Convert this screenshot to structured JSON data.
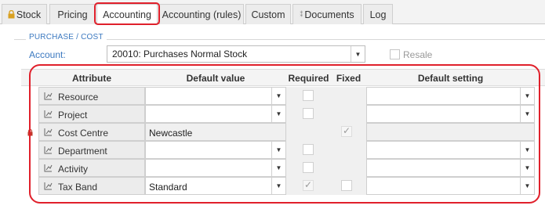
{
  "tabs": [
    {
      "label": "Stock",
      "icon": "lock-icon"
    },
    {
      "label": "Pricing"
    },
    {
      "label": "Accounting",
      "active": true
    },
    {
      "label": "Accounting (rules)"
    },
    {
      "label": "Custom"
    },
    {
      "label": "Documents",
      "icon": "documents-icon"
    },
    {
      "label": "Log"
    }
  ],
  "section": {
    "title": "PURCHASE / COST"
  },
  "account": {
    "label": "Account:",
    "value": "20010: Purchases Normal Stock"
  },
  "resale": {
    "label": "Resale",
    "checked": false
  },
  "table": {
    "headers": {
      "attribute": "Attribute",
      "default_value": "Default value",
      "required": "Required",
      "fixed": "Fixed",
      "default_setting": "Default setting"
    },
    "rows": [
      {
        "attribute": "Resource",
        "default_value": "",
        "required": false,
        "fixed": null,
        "default_setting": "",
        "locked": false
      },
      {
        "attribute": "Project",
        "default_value": "",
        "required": false,
        "fixed": null,
        "default_setting": "",
        "locked": false
      },
      {
        "attribute": "Cost Centre",
        "default_value": "Newcastle",
        "required": null,
        "fixed": true,
        "default_setting": null,
        "locked": true
      },
      {
        "attribute": "Department",
        "default_value": "",
        "required": false,
        "fixed": null,
        "default_setting": "",
        "locked": false
      },
      {
        "attribute": "Activity",
        "default_value": "",
        "required": false,
        "fixed": null,
        "default_setting": "",
        "locked": false
      },
      {
        "attribute": "Tax Band",
        "default_value": "Standard",
        "required": true,
        "fixed": false,
        "default_setting": "",
        "locked": false
      }
    ]
  },
  "colors": {
    "accent": "#3c79c0",
    "highlight": "#e0202b",
    "lock": "#d9a020"
  }
}
